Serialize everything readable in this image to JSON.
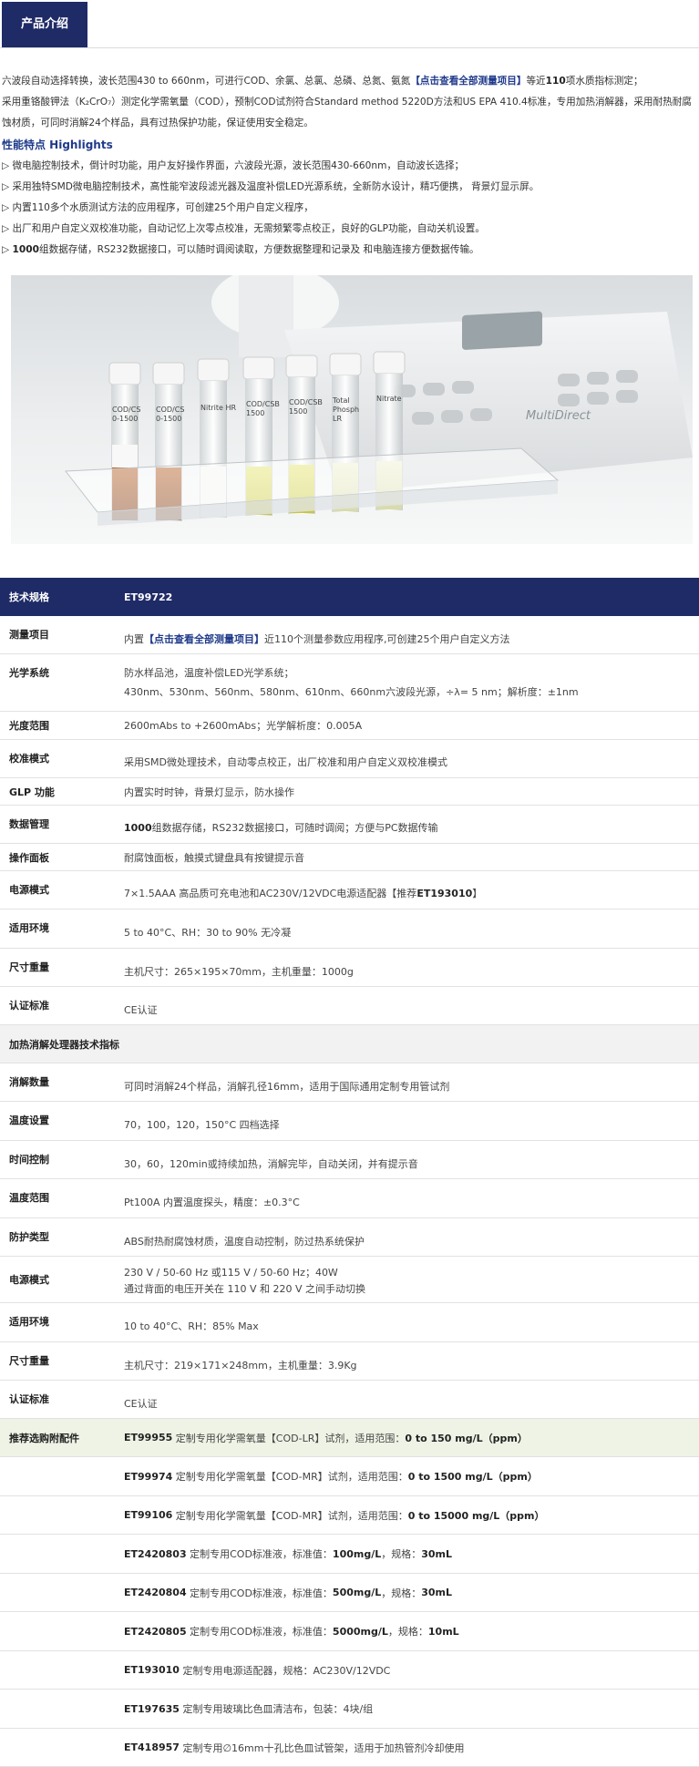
{
  "header": {
    "tab": "产品介绍"
  },
  "intro": {
    "p1_a": "六波段自动选择转换，波长范围430 to 660nm，可进行COD、余氯、总氯、总磷、总氮、氨氮",
    "p1_link": "【点击查看全部测量项目】",
    "p1_b": "等近",
    "p1_bold": "110",
    "p1_c": "项水质指标测定；",
    "p2": "采用重铬酸钾法（K₂CrO₇）测定化学需氧量（COD），预制COD试剂符合Standard method 5220D方法和US EPA 410.4标准，专用加热消解器，采用耐热耐腐蚀材质，可同时消解24个样品，具有过热保护功能，保证使用安全稳定。",
    "highlights_title": "性能特点 Highlights",
    "bullets": [
      "▷ 微电脑控制技术，倒计时功能，用户友好操作界面，六波段光源，波长范围430-660nm，自动波长选择；",
      "▷ 采用独特SMD微电脑控制技术，高性能窄波段滤光器及温度补偿LED光源系统，全新防水设计，精巧便携， 背景灯显示屏。",
      "▷ 内置110多个水质测试方法的应用程序，可创建25个用户自定义程序，",
      "▷ 出厂和用户自定义双校准功能，自动记忆上次零点校准，无需频繁零点校正，良好的GLP功能，自动关机设置。"
    ],
    "b5_arrow": "▷",
    "b5_bold": "1000",
    "b5_rest": "组数据存储，RS232数据接口，可以随时调阅读取，方便数据整理和记录及  和电脑连接方便数据传输。"
  },
  "photo": {
    "vial_labels": [
      "COD/CS\n0-1500",
      "COD/CS\n0-1500",
      "Nitrite HR",
      "COD/CSB\n1500",
      "COD/CSB\n1500",
      "Total\nPhosph\nLR",
      "Nitrate"
    ],
    "device_brand": "MultiDirect"
  },
  "spec": {
    "head_k": "技术规格",
    "head_v": "ET99722",
    "measure_k": "测量项目",
    "measure_pre": "内置",
    "measure_link": "【点击查看全部测量项目】",
    "measure_post": "近110个测量参数应用程序,可创建25个用户自定义方法",
    "optics_k": "光学系统",
    "optics_v1": "防水样品池，温度补偿LED光学系统；",
    "optics_v2": "430nm、530nm、560nm、580nm、610nm、660nm六波段光源，÷λ= 5 nm；解析度：±1nm",
    "range_k": "光度范围",
    "range_v": " 2600mAbs to +2600mAbs；光学解析度：0.005A",
    "calib_k": "校准模式",
    "calib_v": "采用SMD微处理技术，自动零点校正，出厂校准和用户自定义双校准模式",
    "glp_k": "GLP 功能",
    "glp_v": "内置实时时钟，背景灯显示，防水操作",
    "data_k": "数据管理",
    "data_bold": "1000",
    "data_v": "组数据存储，RS232数据接口，可随时调阅；方便与PC数据传输",
    "panel_k": "操作面板",
    "panel_v": "耐腐蚀面板，触摸式键盘具有按键提示音",
    "power_k": "电源模式",
    "power_v": "7×1.5AAA 高品质可充电池和AC230V/12VDC电源适配器【推荐",
    "power_bold": "ET193010",
    "power_end": "】",
    "env_k": "适用环境",
    "env_v": "5 to 40°C、RH：30 to 90% 无冷凝",
    "size_k": "尺寸重量",
    "size_v": "主机尺寸：265×195×70mm，主机重量：1000g",
    "cert_k": "认证标准",
    "cert_v": "CE认证",
    "section2": "加热消解处理器技术指标",
    "d_count_k": "消解数量",
    "d_count_v": "可同时消解24个样品，消解孔径16mm，适用于国际通用定制专用管试剂",
    "d_temp_k": "温度设置",
    "d_temp_v": "70，100，120，150°C 四档选择",
    "d_time_k": "时间控制",
    "d_time_v": "30，60，120min或持续加热，消解完毕，自动关闭，并有提示音",
    "d_trange_k": "温度范围",
    "d_trange_v": "Pt100A 内置温度探头，精度：±0.3°C",
    "d_protect_k": "防护类型",
    "d_protect_v": "ABS耐热耐腐蚀材质，温度自动控制，防过热系统保护",
    "d_power_k": "电源模式",
    "d_power_v1": "230 V / 50-60 Hz 或115 V / 50-60 Hz；40W",
    "d_power_v2": "通过背面的电压开关在 110 V 和 220 V 之间手动切换",
    "d_env_k": "适用环境",
    "d_env_v": "10 to 40°C、RH：85% Max",
    "d_size_k": "尺寸重量",
    "d_size_v": "主机尺寸：219×171×248mm，主机重量：3.9Kg",
    "d_cert_k": "认证标准",
    "d_cert_v": "CE认证",
    "acc_k": "推荐选购附配件",
    "accessories": [
      {
        "code": "ET99955",
        "text": "定制专用化学需氧量【COD-LR】试剂，适用范围：",
        "bold": "0 to 150 mg/L（ppm）"
      },
      {
        "code": "ET99974",
        "text": "定制专用化学需氧量【COD-MR】试剂，适用范围：",
        "bold": "0 to 1500 mg/L（ppm）"
      },
      {
        "code": "ET99106",
        "text": "定制专用化学需氧量【COD-MR】试剂，适用范围：",
        "bold": "0 to 15000 mg/L（ppm）"
      },
      {
        "code": "ET2420803",
        "text": "定制专用COD标准液，标准值：",
        "bold": "100mg/L",
        "text2": "，规格：",
        "bold2": "30mL"
      },
      {
        "code": "ET2420804",
        "text": "定制专用COD标准液，标准值：",
        "bold": "500mg/L",
        "text2": "，规格：",
        "bold2": "30mL"
      },
      {
        "code": "ET2420805",
        "text": "定制专用COD标准液，标准值：",
        "bold": "5000mg/L",
        "text2": "，规格：",
        "bold2": "10mL"
      },
      {
        "code": "ET193010",
        "text": "定制专用电源适配器，规格：AC230V/12VDC"
      },
      {
        "code": "ET197635",
        "text": "定制专用玻璃比色皿清洁布，包装：4块/组"
      },
      {
        "code": "ET418957",
        "text": "定制专用∅16mm十孔比色皿试管架，适用于加热管剂冷却使用"
      }
    ]
  },
  "colors": {
    "navy": "#1f2b66",
    "link": "#1f3a8a",
    "accent_row": "#eef3e5"
  }
}
